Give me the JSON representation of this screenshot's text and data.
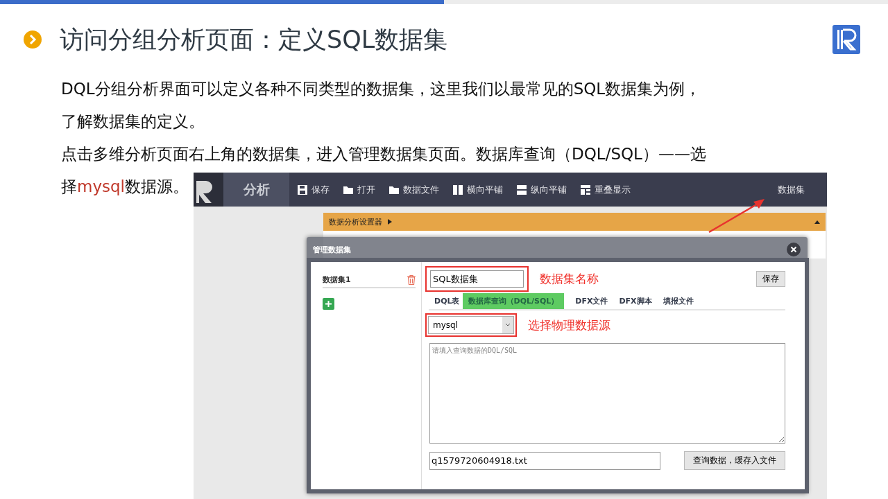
{
  "slide": {
    "title": "访问分组分析页面：定义SQL数据集",
    "lines": [
      [
        {
          "text": "DQL分组分析界面可以定义各种不同类型的数据集，这里我们以最常见的SQL数据集为例，",
          "highlight": false
        }
      ],
      [
        {
          "text": "了解数据集的定义。",
          "highlight": false
        }
      ],
      [
        {
          "text": "点击多维分析页面右上角的数据集，进入管理数据集页面。数据库查询（DQL/SQL）——选",
          "highlight": false
        }
      ],
      [
        {
          "text": "择",
          "highlight": false
        },
        {
          "text": "mysql",
          "highlight": true
        },
        {
          "text": "数据源。",
          "highlight": false
        }
      ]
    ]
  },
  "app": {
    "toolbar": {
      "module": "分析",
      "items": [
        {
          "kind": "save",
          "label": "保存"
        },
        {
          "kind": "open",
          "label": "打开"
        },
        {
          "kind": "file",
          "label": "数据文件"
        },
        {
          "kind": "tile-h",
          "label": "横向平铺"
        },
        {
          "kind": "tile-v",
          "label": "纵向平铺"
        },
        {
          "kind": "overlap",
          "label": "重叠显示"
        }
      ],
      "right_link": "数据集"
    },
    "settings_bar": {
      "title": "数据分析设置器",
      "expanded": false
    },
    "dialog": {
      "title": "管理数据集",
      "datasets": [
        {
          "name": "数据集1",
          "selected": true
        }
      ],
      "name_field": {
        "value": "SQL数据集",
        "annotation": "数据集名称"
      },
      "save_button": "保存",
      "tabs": [
        {
          "label": "DQL表",
          "selected": false
        },
        {
          "label": "数据库查询（DQL/SQL）",
          "selected": true
        },
        {
          "label": "DFX文件",
          "selected": false
        },
        {
          "label": "DFX脚本",
          "selected": false
        },
        {
          "label": "填报文件",
          "selected": false
        }
      ],
      "source_select": {
        "value": "mysql",
        "annotation": "选择物理数据源"
      },
      "query_area": {
        "placeholder": "请填入查询数据的DQL/SQL"
      },
      "file_field": {
        "value": "q1579720604918.txt"
      },
      "query_button": "查询数据，缓存入文件"
    }
  }
}
